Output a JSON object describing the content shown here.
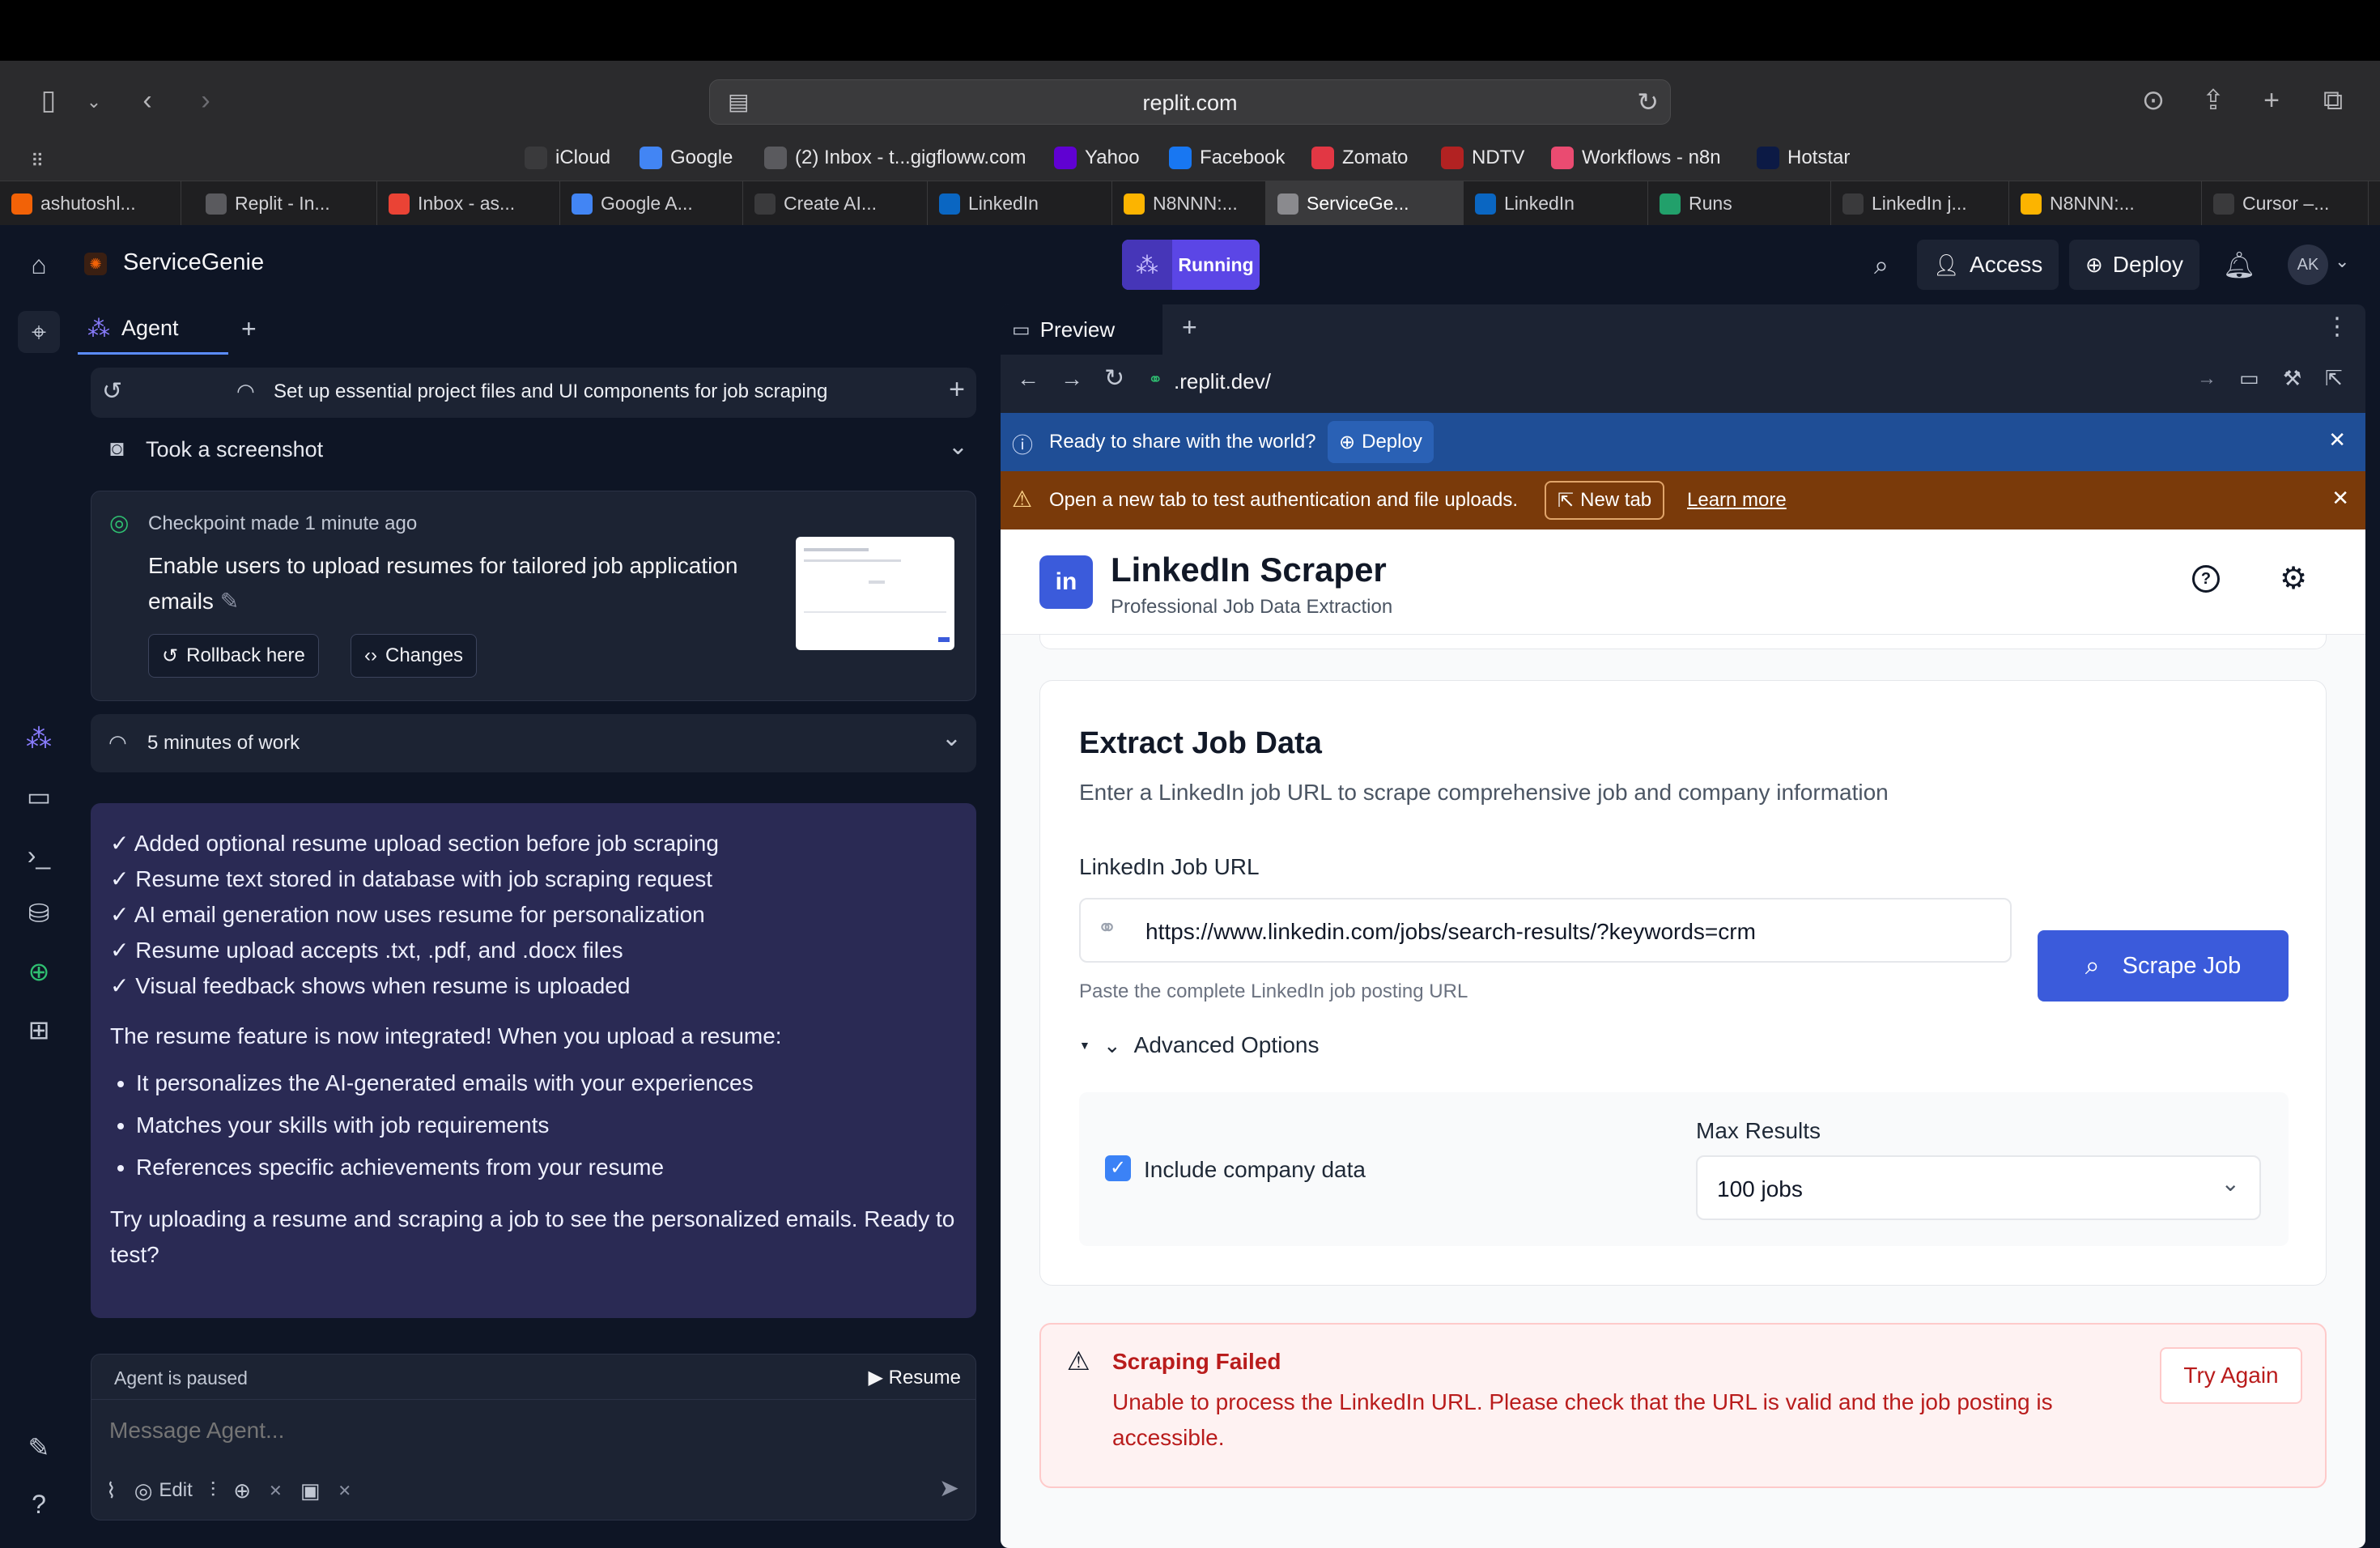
{
  "browser": {
    "url": "replit.com",
    "favorites": [
      {
        "label": "iCloud",
        "icon": "apple-icon",
        "color": "#3a3a3c"
      },
      {
        "label": "Google",
        "icon": "google-icon",
        "color": "#4285f4"
      },
      {
        "label": "(2) Inbox - t...gigfloww.com",
        "icon": "globe-icon",
        "color": "#5a5a5e"
      },
      {
        "label": "Yahoo",
        "icon": "yahoo-icon",
        "color": "#6001d2"
      },
      {
        "label": "Facebook",
        "icon": "facebook-icon",
        "color": "#1877f2"
      },
      {
        "label": "Zomato",
        "icon": "zomato-icon",
        "color": "#e23744"
      },
      {
        "label": "NDTV",
        "icon": "ndtv-icon",
        "color": "#b22222"
      },
      {
        "label": "Workflows - n8n",
        "icon": "n8n-icon",
        "color": "#ea4b71"
      },
      {
        "label": "Hotstar",
        "icon": "hotstar-icon",
        "color": "#0c1a45"
      }
    ],
    "tabs": [
      {
        "label": "ashutoshl...",
        "icon": "replit-icon",
        "color": "#f26207"
      },
      {
        "label": "Replit - In...",
        "icon": "page-icon",
        "color": "#5a5a5e"
      },
      {
        "label": "Inbox - as...",
        "icon": "gmail-icon",
        "color": "#ea4335"
      },
      {
        "label": "Google A...",
        "icon": "google-icon",
        "color": "#4285f4"
      },
      {
        "label": "Create AI...",
        "icon": "openai-icon",
        "color": "#3a3a3c"
      },
      {
        "label": "LinkedIn",
        "icon": "linkedin-icon",
        "color": "#0a66c2"
      },
      {
        "label": "N8NNN:...",
        "icon": "airtable-icon",
        "color": "#fcb400"
      },
      {
        "label": "ServiceGe...",
        "icon": "replit-r-icon",
        "color": "#8a8a8e"
      },
      {
        "label": "LinkedIn",
        "icon": "linkedin-icon",
        "color": "#0a66c2"
      },
      {
        "label": "Runs",
        "icon": "runs-icon",
        "color": "#22a06b"
      },
      {
        "label": "LinkedIn j...",
        "icon": "openai-icon",
        "color": "#3a3a3c"
      },
      {
        "label": "N8NNN:...",
        "icon": "airtable-icon",
        "color": "#fcb400"
      },
      {
        "label": "Cursor –...",
        "icon": "cursor-icon",
        "color": "#3a3a3c"
      }
    ]
  },
  "app": {
    "project_name": "ServiceGenie",
    "status": "Running",
    "access_label": "Access",
    "deploy_label": "Deploy",
    "avatar": "AK"
  },
  "agent": {
    "tab_label": "Agent",
    "task_title": "Set up essential project files and UI components for job scraping",
    "screenshot_label": "Took a screenshot",
    "checkpoint": {
      "meta": "Checkpoint made 1 minute ago",
      "title": "Enable users to upload resumes for tailored job application emails",
      "rollback": "Rollback here",
      "changes": "Changes"
    },
    "work_label": "5 minutes of work",
    "message": {
      "checks": [
        "✓ Added optional resume upload section before job scraping",
        "✓ Resume text stored in database with job scraping request",
        "✓ AI email generation now uses resume for personalization",
        "✓ Resume upload accepts .txt, .pdf, and .docx files",
        "✓ Visual feedback shows when resume is uploaded"
      ],
      "intro": "The resume feature is now integrated! When you upload a resume:",
      "bullets": [
        "It personalizes the AI-generated emails with your experiences",
        "Matches your skills with job requirements",
        "References specific achievements from your resume"
      ],
      "closing": "Try uploading a resume and scraping a job to see the personalized emails. Ready to test?"
    },
    "paused_label": "Agent is paused",
    "resume_label": "Resume",
    "placeholder": "Message Agent...",
    "edit_label": "Edit"
  },
  "preview": {
    "tab_label": "Preview",
    "address": ".replit.dev/",
    "banner_deploy_text": "Ready to share with the world?",
    "banner_deploy_btn": "Deploy",
    "banner_warn_text": "Open a new tab to test authentication and file uploads.",
    "banner_newtab": "New tab",
    "banner_learn": "Learn more"
  },
  "site": {
    "title": "LinkedIn Scraper",
    "subtitle": "Professional Job Data Extraction",
    "section_title": "Extract Job Data",
    "section_desc": "Enter a LinkedIn job URL to scrape comprehensive job and company information",
    "url_label": "LinkedIn Job URL",
    "url_value": "https://www.linkedin.com/jobs/search-results/?keywords=crm",
    "url_hint": "Paste the complete LinkedIn job posting URL",
    "scrape_btn": "Scrape Job",
    "advanced_label": "Advanced Options",
    "include_company": "Include company data",
    "include_company_checked": true,
    "max_results_label": "Max Results",
    "max_results_value": "100 jobs",
    "error_title": "Scraping Failed",
    "error_msg": "Unable to process the LinkedIn URL. Please check that the URL is valid and the job posting is accessible.",
    "try_again": "Try Again"
  },
  "colors": {
    "accent": "#3b5bdb",
    "status_purple": "#5b46e6",
    "message_bg": "#2a2a54",
    "deploy_banner": "#1f4e96",
    "warn_banner": "#7a3a0a",
    "error_red": "#b91c1c"
  }
}
